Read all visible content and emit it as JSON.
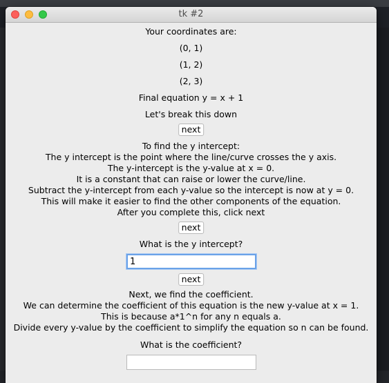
{
  "window": {
    "title": "tk #2"
  },
  "coords_heading": "Your coordinates are:",
  "coordinates": [
    "(0, 1)",
    "(1, 2)",
    "(2, 3)"
  ],
  "final_equation": "Final equation y = x + 1",
  "break_down": "Let's break this down",
  "buttons": {
    "next1": "next",
    "next2": "next",
    "next3": "next"
  },
  "y_intercept_explanation": [
    "To find the y intercept:",
    "The y intercept is the point where the line/curve crosses the y axis.",
    "The y-intercept is the y-value at x = 0.",
    "It is a constant that can raise or lower the curve/line.",
    "Subtract the y-intercept from each y-value so the intercept is now at y = 0.",
    "This will make it easier to find the other components of the equation.",
    "After you complete this, click next"
  ],
  "y_intercept_question": "What is the y intercept?",
  "y_intercept_input": {
    "value": "1"
  },
  "coefficient_explanation": [
    "Next, we find the coefficient.",
    "We can determine the coefficient of this equation is the new y-value at x = 1.",
    "This is because a*1^n for any n equals a.",
    "Divide every y-value by the coefficient to simplify the equation so n can be found."
  ],
  "coefficient_question": "What is the coefficient?",
  "coefficient_input": {
    "value": ""
  }
}
